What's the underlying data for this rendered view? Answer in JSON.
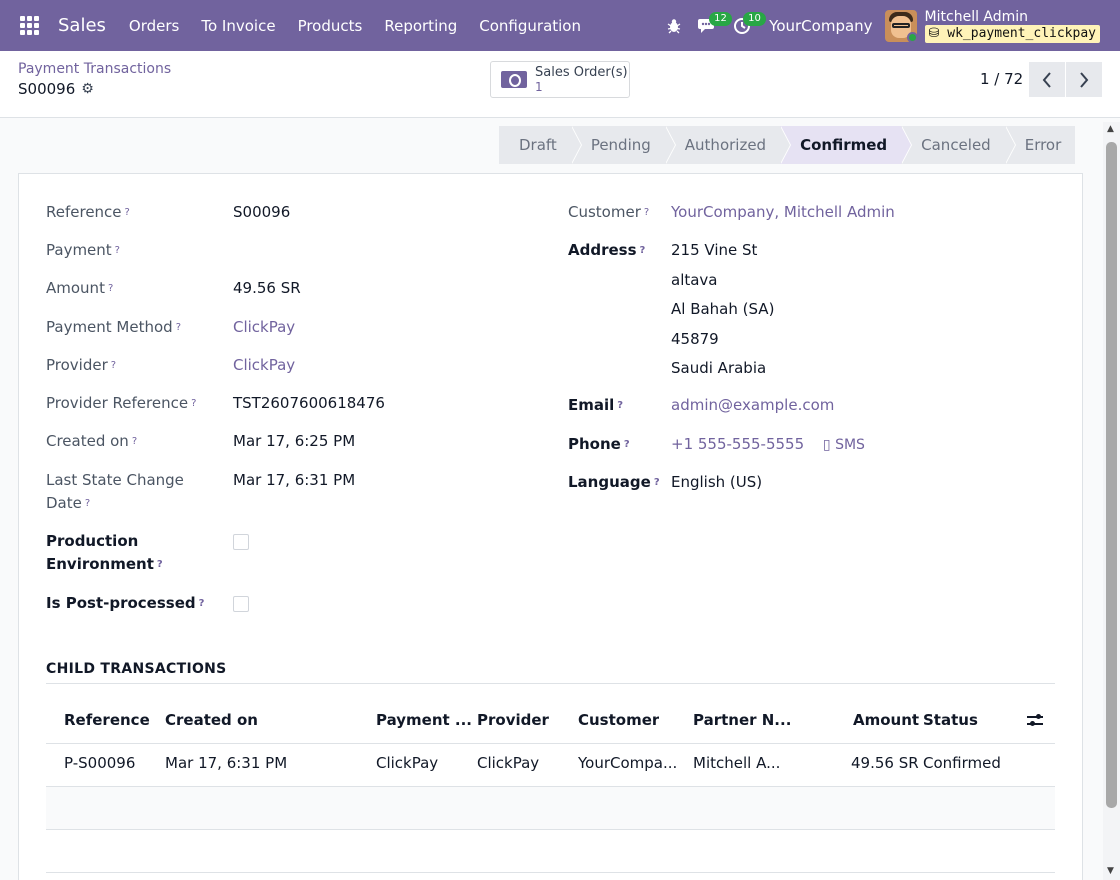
{
  "navbar": {
    "app_name": "Sales",
    "menu": [
      "Orders",
      "To Invoice",
      "Products",
      "Reporting",
      "Configuration"
    ],
    "chat_badge": "12",
    "activity_badge": "10",
    "company": "YourCompany",
    "user_name": "Mitchell Admin",
    "database": "wk_payment_clickpay"
  },
  "control": {
    "breadcrumb": "Payment Transactions",
    "record": "S00096",
    "smart_button": {
      "label": "Sales Order(s)",
      "count": "1"
    },
    "pager": "1 / 72"
  },
  "statusbar": {
    "stages": [
      "Draft",
      "Pending",
      "Authorized",
      "Confirmed",
      "Canceled",
      "Error"
    ],
    "active": "Confirmed"
  },
  "form": {
    "left": {
      "reference": {
        "label": "Reference",
        "value": "S00096"
      },
      "payment": {
        "label": "Payment",
        "value": ""
      },
      "amount": {
        "label": "Amount",
        "value": "49.56 SR"
      },
      "payment_method": {
        "label": "Payment Method",
        "value": "ClickPay"
      },
      "provider": {
        "label": "Provider",
        "value": "ClickPay"
      },
      "provider_reference": {
        "label": "Provider Reference",
        "value": "TST2607600618476"
      },
      "created_on": {
        "label": "Created on",
        "value": "Mar 17, 6:25 PM"
      },
      "last_state_change_line1": "Last State Change",
      "last_state_change_line2": "Date",
      "last_state_change_value": "Mar 17, 6:31 PM",
      "production_line1": "Production",
      "production_line2": "Environment",
      "post_processed": "Is Post-processed"
    },
    "right": {
      "customer": {
        "label": "Customer",
        "value": "YourCompany, Mitchell Admin"
      },
      "address": {
        "label": "Address",
        "lines": [
          "215 Vine St",
          "altava",
          "Al Bahah (SA)",
          "45879",
          "Saudi Arabia"
        ]
      },
      "email": {
        "label": "Email",
        "value": "admin@example.com"
      },
      "phone": {
        "label": "Phone",
        "value": "+1 555-555-5555",
        "sms": "SMS"
      },
      "language": {
        "label": "Language",
        "value": "English (US)"
      }
    },
    "help_mark": "?"
  },
  "child_transactions": {
    "title": "CHILD TRANSACTIONS",
    "columns": [
      "Reference",
      "Created on",
      "Payment ...",
      "Provider",
      "Customer",
      "Partner N...",
      "Amount",
      "Status"
    ],
    "rows": [
      [
        "P-S00096",
        "Mar 17, 6:31 PM",
        "ClickPay",
        "ClickPay",
        "YourCompa...",
        "Mitchell A...",
        "49.56 SR",
        "Confirmed"
      ]
    ]
  }
}
